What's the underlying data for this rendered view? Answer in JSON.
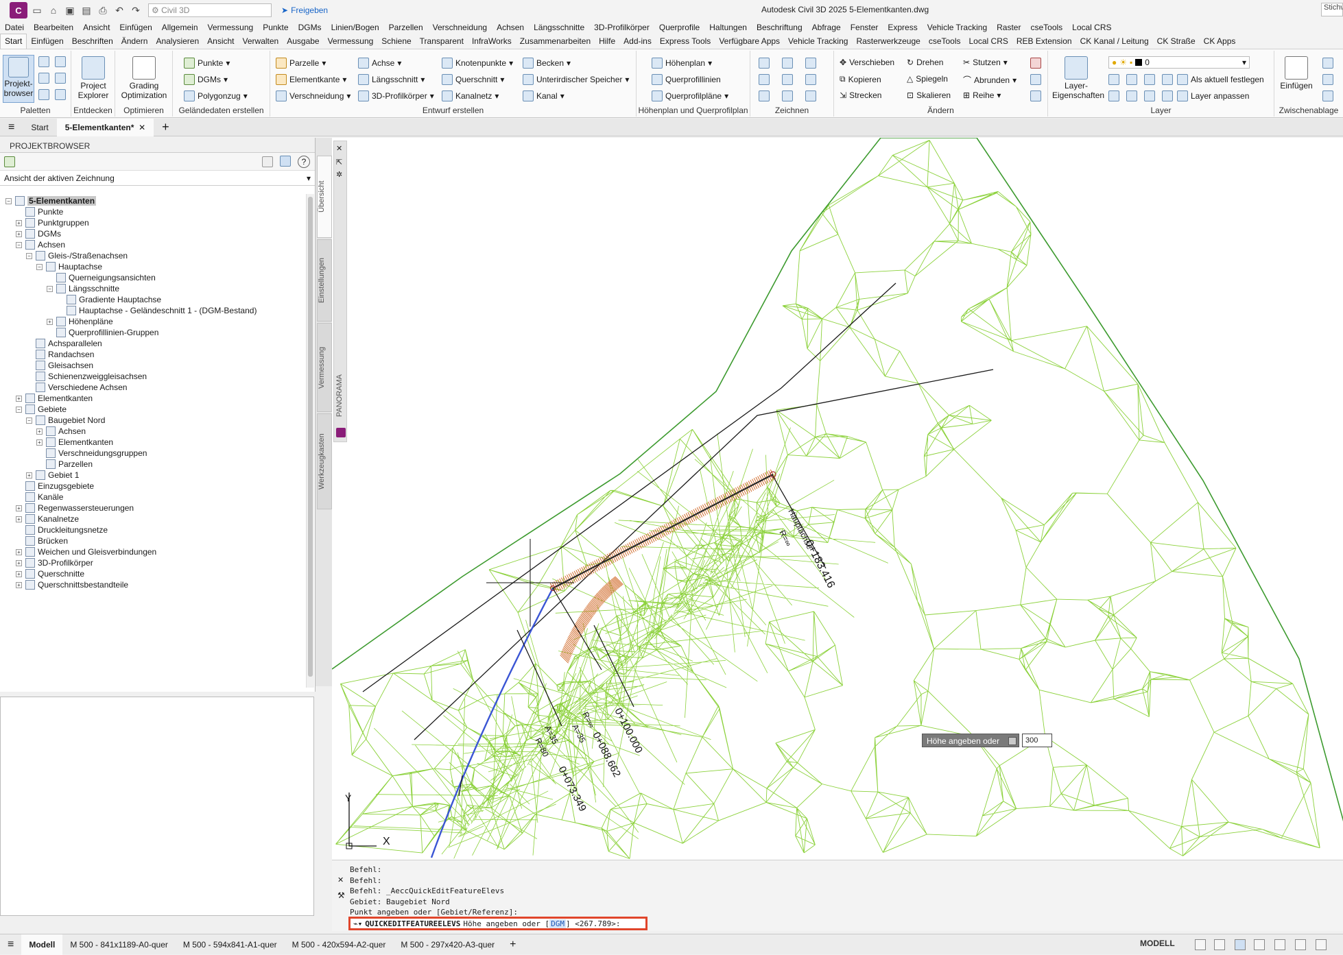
{
  "title_bar": {
    "app_letter": "C",
    "workspace": "Civil 3D",
    "share_label": "Freigeben",
    "window_title": "Autodesk Civil 3D 2025  5-Elementkanten.dwg",
    "help_search": "Stichw"
  },
  "menu": [
    "Datei",
    "Bearbeiten",
    "Ansicht",
    "Einfügen",
    "Allgemein",
    "Vermessung",
    "Punkte",
    "DGMs",
    "Linien/Bogen",
    "Parzellen",
    "Verschneidung",
    "Achsen",
    "Längsschnitte",
    "3D-Profilkörper",
    "Querprofile",
    "Haltungen",
    "Beschriftung",
    "Abfrage",
    "Fenster",
    "Express",
    "Vehicle Tracking",
    "Raster",
    "cseTools",
    "Local CRS"
  ],
  "ribbon_tabs": [
    "Start",
    "Einfügen",
    "Beschriften",
    "Ändern",
    "Analysieren",
    "Ansicht",
    "Verwalten",
    "Ausgabe",
    "Vermessung",
    "Schiene",
    "Transparent",
    "InfraWorks",
    "Zusammenarbeiten",
    "Hilfe",
    "Add-ins",
    "Express Tools",
    "Verfügbare Apps",
    "Vehicle Tracking",
    "Rasterwerkzeuge",
    "cseTools",
    "Local CRS",
    "REB Extension",
    "CK Kanal / Leitung",
    "CK Straße",
    "CK Apps"
  ],
  "ribbon": {
    "paletten": {
      "title": "Paletten",
      "big": "Projekt-\nbrowser"
    },
    "entdecken": {
      "title": "Entdecken",
      "big": "Project\nExplorer"
    },
    "optimieren": {
      "title": "Optimieren",
      "big": "Grading\nOptimization"
    },
    "gelaende": {
      "title": "Geländedaten erstellen",
      "items": [
        "Punkte",
        "DGMs",
        "Polygonzug"
      ]
    },
    "entwurf": {
      "title": "Entwurf erstellen",
      "items": [
        "Parzelle",
        "Elementkante",
        "Verschneidung",
        "Achse",
        "Längsschnitt",
        "3D-Profilkörper",
        "Knotenpunkte",
        "Querschnitt",
        "Kanalnetz",
        "Becken",
        "Unterirdischer Speicher",
        "Kanal"
      ]
    },
    "hoehenplan": {
      "title": "Höhenplan und Querprofilplan",
      "items": [
        "Höhenplan",
        "Querprofillinien",
        "Querprofilpläne"
      ]
    },
    "zeichnen": {
      "title": "Zeichnen"
    },
    "aendern": {
      "title": "Ändern",
      "items": [
        "Verschieben",
        "Drehen",
        "Stutzen",
        "Kopieren",
        "Spiegeln",
        "Abrunden",
        "Strecken",
        "Skalieren",
        "Reihe"
      ]
    },
    "layer": {
      "title": "Layer",
      "big": "Layer-\nEigenschaften",
      "layer_value": "0",
      "items": [
        "Als aktuell festlegen",
        "Layer anpassen"
      ]
    },
    "zwischenablage": {
      "title": "Zwischenablage",
      "big": "Einfügen"
    }
  },
  "doc_tabs": {
    "menu_icon": "hamburger-icon",
    "start": "Start",
    "active": "5-Elementkanten*",
    "add": "+"
  },
  "browser": {
    "header": "PROJEKTBROWSER",
    "view_select": "Ansicht der aktiven Zeichnung",
    "tree": [
      {
        "label": "5-Elementkanten",
        "level": 0,
        "toggle": "-",
        "selected": true
      },
      {
        "label": "Punkte",
        "level": 1,
        "toggle": ""
      },
      {
        "label": "Punktgruppen",
        "level": 1,
        "toggle": "+"
      },
      {
        "label": "DGMs",
        "level": 1,
        "toggle": "+"
      },
      {
        "label": "Achsen",
        "level": 1,
        "toggle": "-"
      },
      {
        "label": "Gleis-/Straßenachsen",
        "level": 2,
        "toggle": "-"
      },
      {
        "label": "Hauptachse",
        "level": 3,
        "toggle": "-"
      },
      {
        "label": "Querneigungsansichten",
        "level": 4,
        "toggle": ""
      },
      {
        "label": "Längsschnitte",
        "level": 4,
        "toggle": "-"
      },
      {
        "label": "Gradiente Hauptachse",
        "level": 5,
        "toggle": ""
      },
      {
        "label": "Hauptachse - Geländeschnitt 1 - (DGM-Bestand)",
        "level": 5,
        "toggle": ""
      },
      {
        "label": "Höhenpläne",
        "level": 4,
        "toggle": "+"
      },
      {
        "label": "Querprofillinien-Gruppen",
        "level": 4,
        "toggle": ""
      },
      {
        "label": "Achsparallelen",
        "level": 2,
        "toggle": ""
      },
      {
        "label": "Randachsen",
        "level": 2,
        "toggle": ""
      },
      {
        "label": "Gleisachsen",
        "level": 2,
        "toggle": ""
      },
      {
        "label": "Schienenzweiggleisachsen",
        "level": 2,
        "toggle": ""
      },
      {
        "label": "Verschiedene Achsen",
        "level": 2,
        "toggle": ""
      },
      {
        "label": "Elementkanten",
        "level": 1,
        "toggle": "+"
      },
      {
        "label": "Gebiete",
        "level": 1,
        "toggle": "-"
      },
      {
        "label": "Baugebiet Nord",
        "level": 2,
        "toggle": "-"
      },
      {
        "label": "Achsen",
        "level": 3,
        "toggle": "+"
      },
      {
        "label": "Elementkanten",
        "level": 3,
        "toggle": "+"
      },
      {
        "label": "Verschneidungsgruppen",
        "level": 3,
        "toggle": ""
      },
      {
        "label": "Parzellen",
        "level": 3,
        "toggle": ""
      },
      {
        "label": "Gebiet 1",
        "level": 2,
        "toggle": "+"
      },
      {
        "label": "Einzugsgebiete",
        "level": 1,
        "toggle": ""
      },
      {
        "label": "Kanäle",
        "level": 1,
        "toggle": ""
      },
      {
        "label": "Regenwassersteuerungen",
        "level": 1,
        "toggle": "+"
      },
      {
        "label": "Kanalnetze",
        "level": 1,
        "toggle": "+"
      },
      {
        "label": "Druckleitungsnetze",
        "level": 1,
        "toggle": ""
      },
      {
        "label": "Brücken",
        "level": 1,
        "toggle": ""
      },
      {
        "label": "Weichen und Gleisverbindungen",
        "level": 1,
        "toggle": "+"
      },
      {
        "label": "3D-Profilkörper",
        "level": 1,
        "toggle": "+"
      },
      {
        "label": "Querschnitte",
        "level": 1,
        "toggle": "+"
      },
      {
        "label": "Querschnittsbestandteile",
        "level": 1,
        "toggle": "+"
      }
    ]
  },
  "side_tabs": [
    "Übersicht",
    "Einstellungen",
    "Vermessung",
    "Werkzeugkasten"
  ],
  "panorama_label": "PANORAMA",
  "viewport": {
    "dynamic_prompt": "Höhe angeben oder",
    "dynamic_value": "300",
    "labels": {
      "hauptachse": "Hauptachse",
      "r_inf_1": "R=∞",
      "station_end": "0+183.416",
      "a35_1": "A=35",
      "r80": "R=80",
      "station_73": "0+073.349",
      "a35_2": "A=35",
      "r_inf_2": "R=∞",
      "station_88": "0+088.662",
      "station_100": "0+100.000"
    },
    "ucs": {
      "x": "X",
      "y": "Y"
    },
    "colors": {
      "tin": "#8bd13a",
      "boundary": "#3c9a2e",
      "alignment": "#1a1a1a",
      "curve": "#3a55d4",
      "hatch": "#d06a2a"
    }
  },
  "command": {
    "history": [
      "Befehl:",
      "Befehl:",
      "Befehl: _AeccQuickEditFeatureElevs",
      "Gebiet: Baugebiet Nord",
      "Punkt angeben oder [Gebiet/Referenz]:"
    ],
    "input_cmd": "QUICKEDITFEATUREELEVS",
    "input_prompt": "Höhe angeben oder",
    "input_option": "DGM",
    "input_default": "<267.789>:"
  },
  "status": {
    "layouts": [
      "Modell",
      "M 500 - 841x1189-A0-quer",
      "M 500 - 594x841-A1-quer",
      "M 500 - 420x594-A2-quer",
      "M 500 - 297x420-A3-quer"
    ],
    "model_label": "MODELL"
  }
}
